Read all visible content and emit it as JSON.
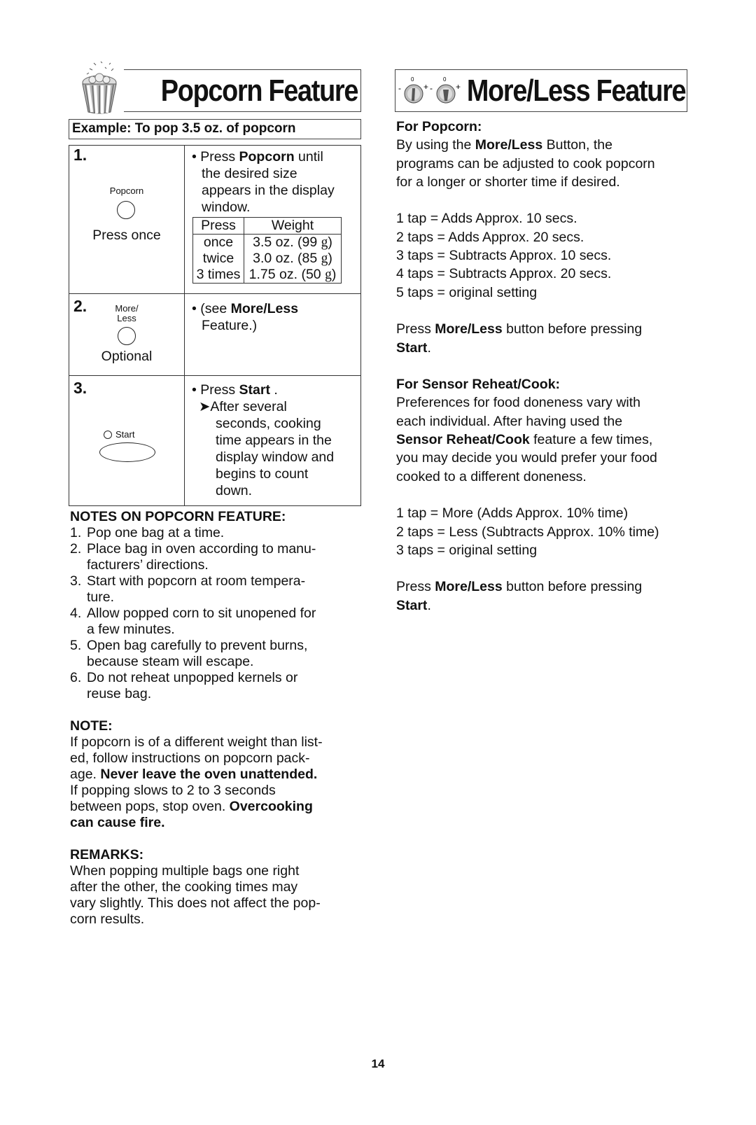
{
  "left_section": {
    "title": "Popcorn Feature",
    "icon": "popcorn-bucket-icon",
    "example": "Example: To pop 3.5 oz. of popcorn",
    "steps": [
      {
        "number": "1.",
        "button_label": "Popcorn",
        "caption": "Press once",
        "instruction_parts": [
          "• Press ",
          "Popcorn",
          " until"
        ],
        "instruction_lines": [
          "the desired size",
          "appears in the display",
          "window."
        ],
        "weight_table": {
          "headers": [
            "Press",
            "Weight"
          ],
          "rows": [
            {
              "press": "once",
              "weight": "3.5 oz. (99 ",
              "unit": "g",
              "close": ")"
            },
            {
              "press": "twice",
              "weight": "3.0 oz. (85 ",
              "unit": "g",
              "close": ")"
            },
            {
              "press": "3 times",
              "weight": "1.75 oz. (50 ",
              "unit": "g",
              "close": ")"
            }
          ]
        }
      },
      {
        "number": "2.",
        "button_label_1": "More/",
        "button_label_2": "Less",
        "caption": "Optional",
        "instruction_parts": [
          "• (see ",
          "More/Less"
        ],
        "instruction_line2": "Feature.)"
      },
      {
        "number": "3.",
        "button_label": "Start",
        "instruction_parts": [
          "• Press ",
          "Start",
          " ."
        ],
        "arrow": "➤",
        "result_lines": [
          "After several",
          "seconds, cooking",
          "time appears in the",
          "display window and",
          "begins to count",
          "down."
        ]
      }
    ],
    "notes": {
      "heading": "NOTES ON POPCORN FEATURE:",
      "items": [
        {
          "n": "1.",
          "lines": [
            "Pop one bag at a time."
          ]
        },
        {
          "n": "2.",
          "lines": [
            "Place bag in oven according to manu-",
            "facturers’ directions."
          ]
        },
        {
          "n": "3.",
          "lines": [
            "Start with popcorn at room tempera-",
            "ture."
          ]
        },
        {
          "n": "4.",
          "lines": [
            "Allow popped corn to sit unopened for",
            "a few minutes."
          ]
        },
        {
          "n": "5.",
          "lines": [
            "Open bag carefully to prevent burns,",
            "because steam will escape."
          ]
        },
        {
          "n": "6.",
          "lines": [
            "Do not reheat unpopped kernels or",
            "reuse bag."
          ]
        }
      ]
    },
    "note": {
      "heading": "NOTE:",
      "line1": "If popcorn is of a different weight than list-",
      "line2": "ed, follow instructions on popcorn pack-",
      "line3_plain": "age. ",
      "line3_bold": "Never leave the oven unattended.",
      "line4": "If popping slows to 2 to 3 seconds",
      "line5_plain": "between pops, stop oven. ",
      "line5_bold": "Overcooking",
      "line6_bold": "can cause fire."
    },
    "remarks": {
      "heading": "REMARKS:",
      "lines": [
        "When popping multiple bags one right",
        "after the other, the cooking times may",
        "vary slightly. This does not affect the pop-",
        "corn results."
      ]
    }
  },
  "right_section": {
    "title": "More/Less Feature",
    "icon": "more-less-dial-icons",
    "popcorn": {
      "heading": "For Popcorn:",
      "intro_plain1": "By using the ",
      "intro_bold": "More/Less",
      "intro_plain2": " Button, the",
      "intro_line2": "programs can be adjusted to cook popcorn",
      "intro_line3": "for a longer or shorter time if desired.",
      "taps": [
        "1 tap = Adds Approx. 10 secs.",
        "2 taps = Adds Approx. 20 secs.",
        "3 taps = Subtracts Approx. 10 secs.",
        "4 taps = Subtracts Approx. 20 secs.",
        "5 taps = original setting"
      ],
      "press_plain1": "Press ",
      "press_bold": "More/Less",
      "press_plain2": " button before pressing",
      "press_start": "Start",
      "press_end": "."
    },
    "sensor": {
      "heading": "For Sensor Reheat/Cook:",
      "line1": "Preferences for food doneness vary with",
      "line2": "each individual. After having used the",
      "line3_bold": "Sensor Reheat/Cook",
      "line3_plain": " feature a few times,",
      "line4": "you may decide you would prefer your food",
      "line5": "cooked to a different doneness.",
      "taps": [
        "1 tap = More (Adds Approx. 10% time)",
        "2 taps = Less (Subtracts Approx. 10% time)",
        "3 taps = original setting"
      ],
      "press_plain1": "Press ",
      "press_bold": "More/Less",
      "press_plain2": " button before pressing",
      "press_start": "Start",
      "press_end": "."
    }
  },
  "page_number": "14"
}
